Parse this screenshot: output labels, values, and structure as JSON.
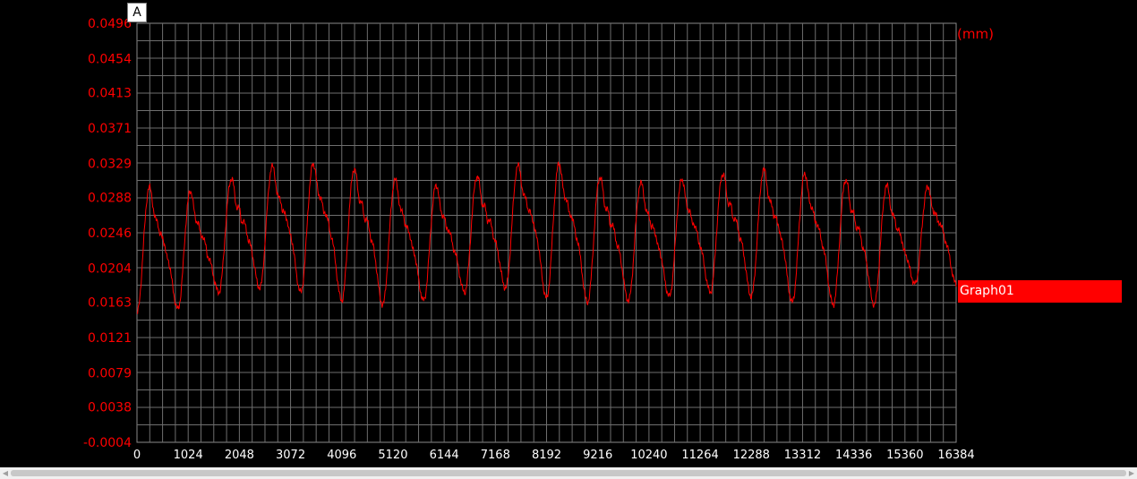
{
  "marker_label": "A",
  "chart_data": {
    "type": "line",
    "title": "",
    "xlabel": "",
    "ylabel": "(mm)",
    "xlim": [
      0,
      16384
    ],
    "ylim": [
      -0.0004,
      0.0496
    ],
    "x_ticks": [
      "0",
      "1024",
      "2048",
      "3072",
      "4096",
      "5120",
      "6144",
      "7168",
      "8192",
      "9216",
      "10240",
      "11264",
      "12288",
      "13312",
      "14336",
      "15360",
      "16384"
    ],
    "y_ticks": [
      "0.0496",
      "0.0454",
      "0.0413",
      "0.0371",
      "0.0329",
      "0.0288",
      "0.0246",
      "0.0204",
      "0.0163",
      "0.0121",
      "0.0079",
      "0.0038",
      "-0.0004"
    ],
    "grid": true,
    "legend_position": "right",
    "colors": {
      "background": "#000000",
      "series": "#ff0000",
      "grid": "#6e6e6e",
      "text": "#ff0000"
    },
    "series": [
      {
        "name": "Graph01",
        "cycle_peaks": [
          0.03,
          0.0295,
          0.031,
          0.0325,
          0.0328,
          0.0322,
          0.0309,
          0.0302,
          0.0313,
          0.0326,
          0.0328,
          0.0312,
          0.0305,
          0.0309,
          0.0316,
          0.0321,
          0.0316,
          0.0309,
          0.0302,
          0.03
        ],
        "cycle_troughs": [
          0.015,
          0.0155,
          0.0175,
          0.018,
          0.0175,
          0.0165,
          0.016,
          0.0165,
          0.0175,
          0.018,
          0.0168,
          0.0163,
          0.0165,
          0.017,
          0.0175,
          0.017,
          0.0163,
          0.016,
          0.016,
          0.0185
        ]
      }
    ]
  }
}
